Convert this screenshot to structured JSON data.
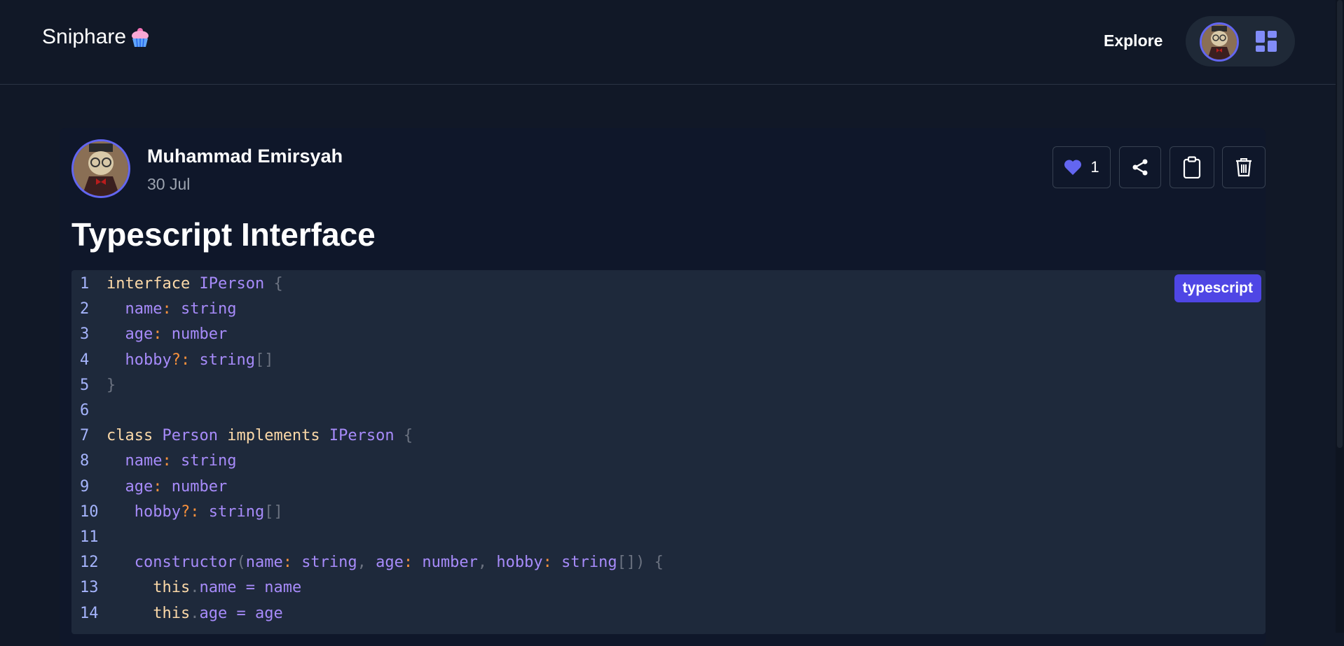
{
  "header": {
    "brand": "Sniphare",
    "nav_explore": "Explore"
  },
  "post": {
    "author_name": "Muhammad Emirsyah",
    "date": "30 Jul",
    "title": "Typescript Interface",
    "like_count": "1",
    "language": "typescript"
  },
  "code": {
    "lines": [
      {
        "n": "1",
        "tokens": [
          [
            "kw",
            "interface"
          ],
          [
            "t",
            " "
          ],
          [
            "id",
            "IPerson"
          ],
          [
            "t",
            " "
          ],
          [
            "pn",
            "{"
          ]
        ]
      },
      {
        "n": "2",
        "tokens": [
          [
            "t",
            "  "
          ],
          [
            "id",
            "name"
          ],
          [
            "op",
            ":"
          ],
          [
            "t",
            " "
          ],
          [
            "id",
            "string"
          ]
        ]
      },
      {
        "n": "3",
        "tokens": [
          [
            "t",
            "  "
          ],
          [
            "id",
            "age"
          ],
          [
            "op",
            ":"
          ],
          [
            "t",
            " "
          ],
          [
            "id",
            "number"
          ]
        ]
      },
      {
        "n": "4",
        "tokens": [
          [
            "t",
            "  "
          ],
          [
            "id",
            "hobby"
          ],
          [
            "op",
            "?:"
          ],
          [
            "t",
            " "
          ],
          [
            "id",
            "string"
          ],
          [
            "pn",
            "[]"
          ]
        ]
      },
      {
        "n": "5",
        "tokens": [
          [
            "pn",
            "}"
          ]
        ]
      },
      {
        "n": "6",
        "tokens": []
      },
      {
        "n": "7",
        "tokens": [
          [
            "kw",
            "class"
          ],
          [
            "t",
            " "
          ],
          [
            "id",
            "Person"
          ],
          [
            "t",
            " "
          ],
          [
            "kw",
            "implements"
          ],
          [
            "t",
            " "
          ],
          [
            "id",
            "IPerson"
          ],
          [
            "t",
            " "
          ],
          [
            "pn",
            "{"
          ]
        ]
      },
      {
        "n": "8",
        "tokens": [
          [
            "t",
            "  "
          ],
          [
            "id",
            "name"
          ],
          [
            "op",
            ":"
          ],
          [
            "t",
            " "
          ],
          [
            "id",
            "string"
          ]
        ]
      },
      {
        "n": "9",
        "tokens": [
          [
            "t",
            "  "
          ],
          [
            "id",
            "age"
          ],
          [
            "op",
            ":"
          ],
          [
            "t",
            " "
          ],
          [
            "id",
            "number"
          ]
        ]
      },
      {
        "n": "10",
        "tokens": [
          [
            "t",
            "   "
          ],
          [
            "id",
            "hobby"
          ],
          [
            "op",
            "?:"
          ],
          [
            "t",
            " "
          ],
          [
            "id",
            "string"
          ],
          [
            "pn",
            "[]"
          ]
        ]
      },
      {
        "n": "11",
        "tokens": []
      },
      {
        "n": "12",
        "tokens": [
          [
            "t",
            "   "
          ],
          [
            "id",
            "constructor"
          ],
          [
            "pn",
            "("
          ],
          [
            "id",
            "name"
          ],
          [
            "op",
            ":"
          ],
          [
            "t",
            " "
          ],
          [
            "id",
            "string"
          ],
          [
            "pn",
            ","
          ],
          [
            "t",
            " "
          ],
          [
            "id",
            "age"
          ],
          [
            "op",
            ":"
          ],
          [
            "t",
            " "
          ],
          [
            "id",
            "number"
          ],
          [
            "pn",
            ","
          ],
          [
            "t",
            " "
          ],
          [
            "id",
            "hobby"
          ],
          [
            "op",
            ":"
          ],
          [
            "t",
            " "
          ],
          [
            "id",
            "string"
          ],
          [
            "pn",
            "[])"
          ],
          [
            "t",
            " "
          ],
          [
            "pn",
            "{"
          ]
        ]
      },
      {
        "n": "13",
        "tokens": [
          [
            "t",
            "     "
          ],
          [
            "kw",
            "this"
          ],
          [
            "pn",
            "."
          ],
          [
            "id",
            "name"
          ],
          [
            "t",
            " "
          ],
          [
            "id",
            "="
          ],
          [
            "t",
            " "
          ],
          [
            "id",
            "name"
          ]
        ]
      },
      {
        "n": "14",
        "tokens": [
          [
            "t",
            "     "
          ],
          [
            "kw",
            "this"
          ],
          [
            "pn",
            "."
          ],
          [
            "id",
            "age"
          ],
          [
            "t",
            " "
          ],
          [
            "id",
            "="
          ],
          [
            "t",
            " "
          ],
          [
            "id",
            "age"
          ]
        ]
      }
    ]
  }
}
